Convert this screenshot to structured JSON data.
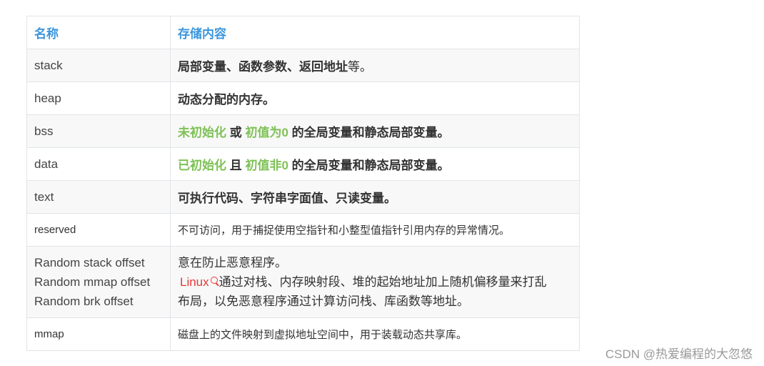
{
  "table": {
    "headers": [
      "名称",
      "存储内容"
    ],
    "rows": [
      {
        "name": "stack",
        "desc_main": "局部变量、函数参数、返回地址",
        "desc_tail": "等。"
      },
      {
        "name": "heap",
        "desc": "动态分配的内存。"
      },
      {
        "name": "bss",
        "hl1": "未初始化",
        "mid": " 或 ",
        "hl2": "初值为0",
        "rest": " 的全局变量和静态局部变量。"
      },
      {
        "name": "data",
        "hl1": "已初始化",
        "mid": " 且 ",
        "hl2": "初值非0",
        "rest": " 的全局变量和静态局部变量。"
      },
      {
        "name": "text",
        "desc": "可执行代码、字符串字面值、只读变量。"
      },
      {
        "name": "reserved",
        "desc": "不可访问，用于捕捉使用空指针和小整型值指针引用内存的异常情况。"
      },
      {
        "names": [
          "Random stack offset",
          "Random mmap offset",
          "Random brk offset"
        ],
        "line1": "意在防止恶意程序。",
        "link": "Linux",
        "line2": "通过对栈、内存映射段、堆的起始地址加上随机偏移量来打乱",
        "line3": "布局，以免恶意程序通过计算访问栈、库函数等地址。"
      },
      {
        "name": "mmap",
        "desc": "磁盘上的文件映射到虚拟地址空间中，用于装载动态共享库。"
      }
    ]
  },
  "watermark": "CSDN @热爱编程的大忽悠",
  "colors": {
    "header": "#3b96dd",
    "highlight": "#7ec156",
    "link": "#e4393c"
  }
}
